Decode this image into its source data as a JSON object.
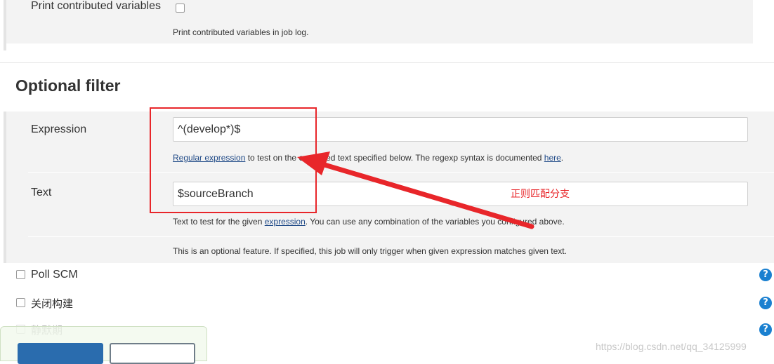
{
  "print_section": {
    "label": "Print contributed variables",
    "description": "Print contributed variables in job log."
  },
  "optional_filter": {
    "title": "Optional filter",
    "expression": {
      "label": "Expression",
      "value": "^(develop*)$",
      "desc_link": "Regular expression",
      "desc_text": " to test on the evaluated text specified below. The regexp syntax is documented ",
      "desc_link2": "here",
      "desc_end": "."
    },
    "text": {
      "label": "Text",
      "value": "$sourceBranch",
      "desc_start": "Text to test for the given ",
      "desc_link": "expression",
      "desc_end": ". You can use any combination of the variables you configured above."
    },
    "footer_note": "This is an optional feature. If specified, this job will only trigger when given expression matches given text."
  },
  "annotation": {
    "text": "正则匹配分支",
    "color": "#e8262a"
  },
  "triggers": [
    {
      "label": "Poll SCM"
    },
    {
      "label": "关闭构建"
    },
    {
      "label": "静默期"
    }
  ],
  "help_icon": "?",
  "watermark": "https://blog.csdn.net/qq_34125999",
  "colors": {
    "help": "#1a80d0",
    "save_button": "#2a6cae",
    "annotation_red": "#e8262a"
  }
}
